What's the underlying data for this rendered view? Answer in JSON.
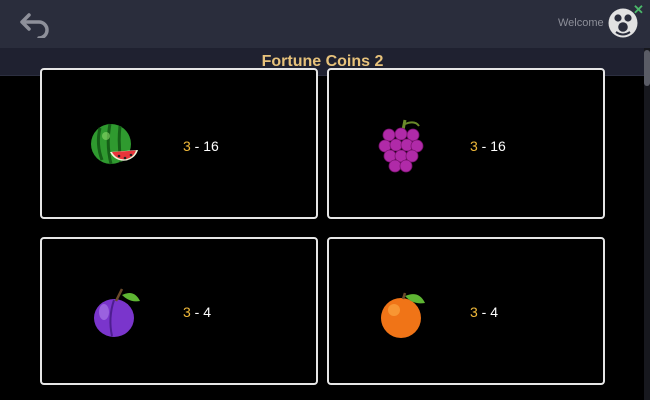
{
  "header": {
    "welcome_text": "Welcome",
    "close_label": "✕",
    "icons": {
      "back": "back-arrow-icon",
      "avatar": "user-avatar-icon",
      "close": "close-icon"
    }
  },
  "title": "Fortune Coins 2",
  "symbols": [
    {
      "fruit": "watermelon",
      "min": "3",
      "sep": " - ",
      "max": "16"
    },
    {
      "fruit": "grapes",
      "min": "3",
      "sep": " - ",
      "max": "16"
    },
    {
      "fruit": "plum",
      "min": "3",
      "sep": " - ",
      "max": "4"
    },
    {
      "fruit": "orange",
      "min": "3",
      "sep": " - ",
      "max": "4"
    }
  ],
  "colors": {
    "title": "#e7c27b",
    "accent_number": "#f0b93a",
    "panel_border": "#e6e6e6",
    "header_bg": "#2a2d3c",
    "close": "#4bb96a"
  }
}
